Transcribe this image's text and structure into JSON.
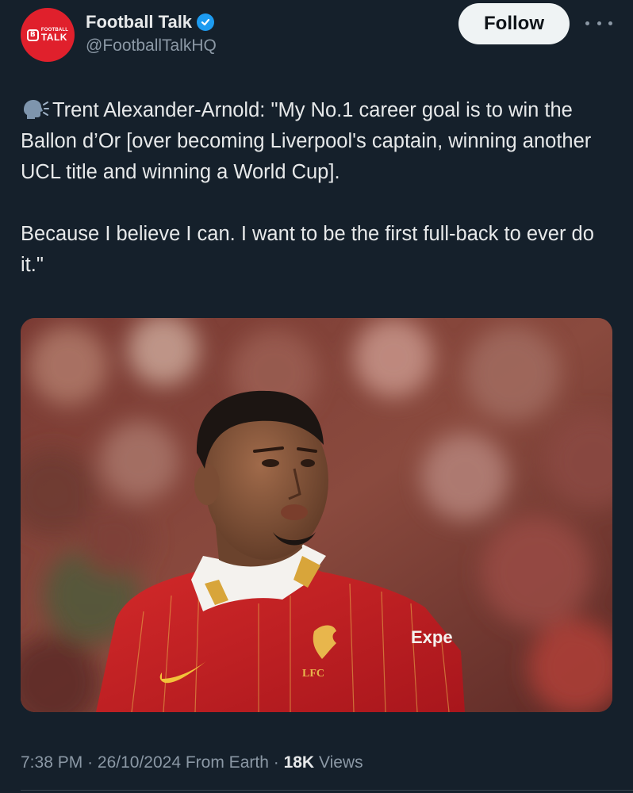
{
  "account": {
    "display_name": "Football Talk",
    "handle": "@FootballTalkHQ",
    "verified": true,
    "avatar_logo_small": "FOOTBALL",
    "avatar_logo_big": "TALK",
    "avatar_logo_badge": "B",
    "avatar_color": "#e0202c"
  },
  "header": {
    "follow_label": "Follow",
    "more_icon": "more-icon"
  },
  "tweet": {
    "speaking_icon": "speaking-head-icon",
    "paragraph_1": "Trent Alexander-Arnold: \"My No.1 career goal is to win the Ballon d’Or [over becoming Liverpool's captain, winning another UCL title and winning a World Cup].",
    "paragraph_2": "Because I believe I can. I want to be the first full-back to ever do it.\""
  },
  "media": {
    "shirt_crest_text": "LFC",
    "shirt_sponsor_text": "Expe"
  },
  "meta": {
    "time": "7:38 PM",
    "date": "26/10/2024",
    "source": "From Earth",
    "views_count": "18K",
    "views_label": "Views",
    "separator": "·"
  },
  "colors": {
    "background": "#15202b",
    "text": "#e7e9ea",
    "muted": "#8b98a5",
    "verified": "#1d9bf0",
    "follow_bg": "#eff3f4"
  }
}
